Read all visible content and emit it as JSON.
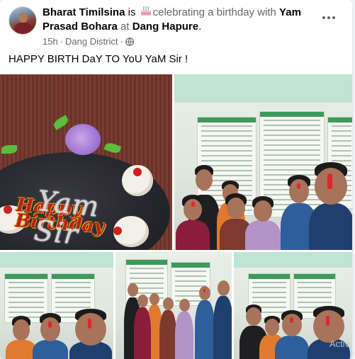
{
  "post": {
    "author": "Bharat Timilsina",
    "is_text": " is ",
    "activity": "celebrating a birthday with ",
    "tagged": "Yam Prasad Bohara",
    "at_text": " at ",
    "location": "Dang Hapure",
    "period": ".",
    "time": "15h",
    "separator": "·",
    "place": "Dang District",
    "privacy_icon": "globe-icon",
    "activity_icon": "birthday-cake-icon",
    "menu_icon": "more-options-icon",
    "text": "HAPPY BIRTH DaY TO YoU YaM Sir !"
  },
  "photos": {
    "cake_topper": "Happy Birthday",
    "cake_writing": "Yam Sir",
    "watermark": "Activ"
  },
  "colors": {
    "accent_green": "#3d9a5a",
    "tika_red": "#e3252b",
    "muted_text": "#65676b"
  }
}
